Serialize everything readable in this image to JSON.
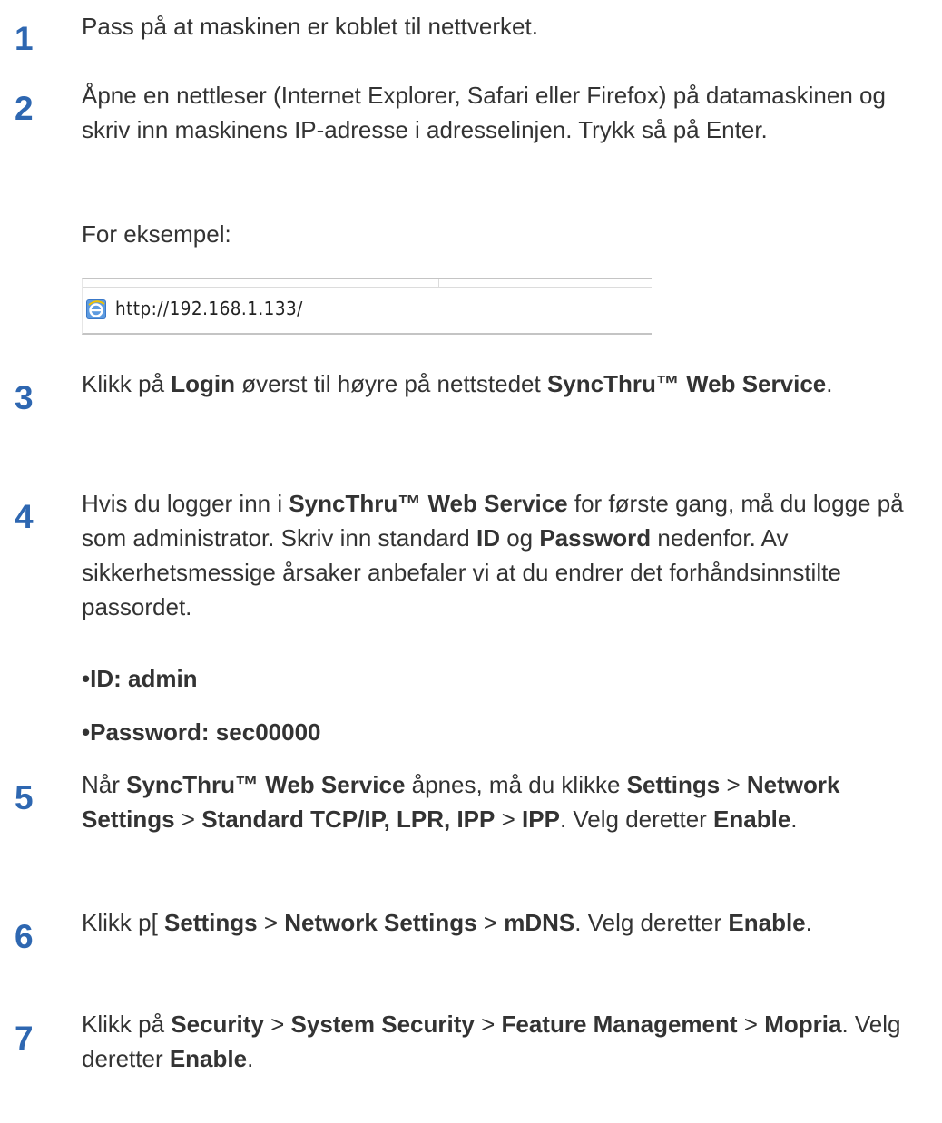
{
  "steps": [
    {
      "num": "1",
      "text": "Pass på at maskinen er koblet til nettverket."
    },
    {
      "num": "2",
      "text": "Åpne en nettleser (Internet Explorer, Safari eller Firefox) på datamaskinen og skriv inn maskinens IP-adresse i adresselinjen. Trykk så på Enter."
    },
    {
      "num": "3",
      "a": "Klikk på ",
      "login": "Login",
      "b": " øverst til høyre på nettstedet ",
      "service": "SyncThru™ Web Service",
      "c": "."
    },
    {
      "num": "4",
      "a": "Hvis du logger inn i ",
      "service": "SyncThru™ Web Service",
      "b": " for første gang, må du logge på som administrator. Skriv inn standard ",
      "id": "ID",
      "og": " og ",
      "password": "Password",
      "c": " nedenfor. Av sikkerhetsmessige årsaker anbefaler vi at du endrer det forhåndsinnstilte passordet."
    },
    {
      "num": "5",
      "a": "Når ",
      "service": "SyncThru™ Web Service",
      "b": " åpnes, må du klikke ",
      "settings": "Settings",
      "sep1": " > ",
      "network": "Network Settings",
      "sep2": " > ",
      "tcp": "Standard TCP/IP, LPR, IPP",
      "sep3": " > ",
      "ipp": "IPP",
      "c": ". Velg deretter ",
      "enable": "Enable",
      "d": "."
    },
    {
      "num": "6",
      "a": "Klikk p[ ",
      "settings": "Settings",
      "sep1": " > ",
      "network": "Network Settings",
      "sep2": " > ",
      "mdns": "mDNS",
      "b": ". Velg deretter ",
      "enable": "Enable",
      "c": "."
    },
    {
      "num": "7",
      "a": "Klikk på ",
      "security": "Security",
      "sep1": " > ",
      "system": "System Security",
      "sep2": " > ",
      "feature": "Feature Management",
      "sep3": " > ",
      "mopria": "Mopria",
      "b": ". Velg deretter ",
      "enable": "Enable",
      "c": "."
    }
  ],
  "example_label": "For eksempel:",
  "url_example": "http://192.168.1.133/",
  "credentials": {
    "id": "•ID: admin",
    "password": "•Password: sec00000"
  },
  "icons": {
    "browser": "internet-explorer-icon"
  },
  "colors": {
    "step_number": "#2e67b1",
    "text": "#333333"
  }
}
